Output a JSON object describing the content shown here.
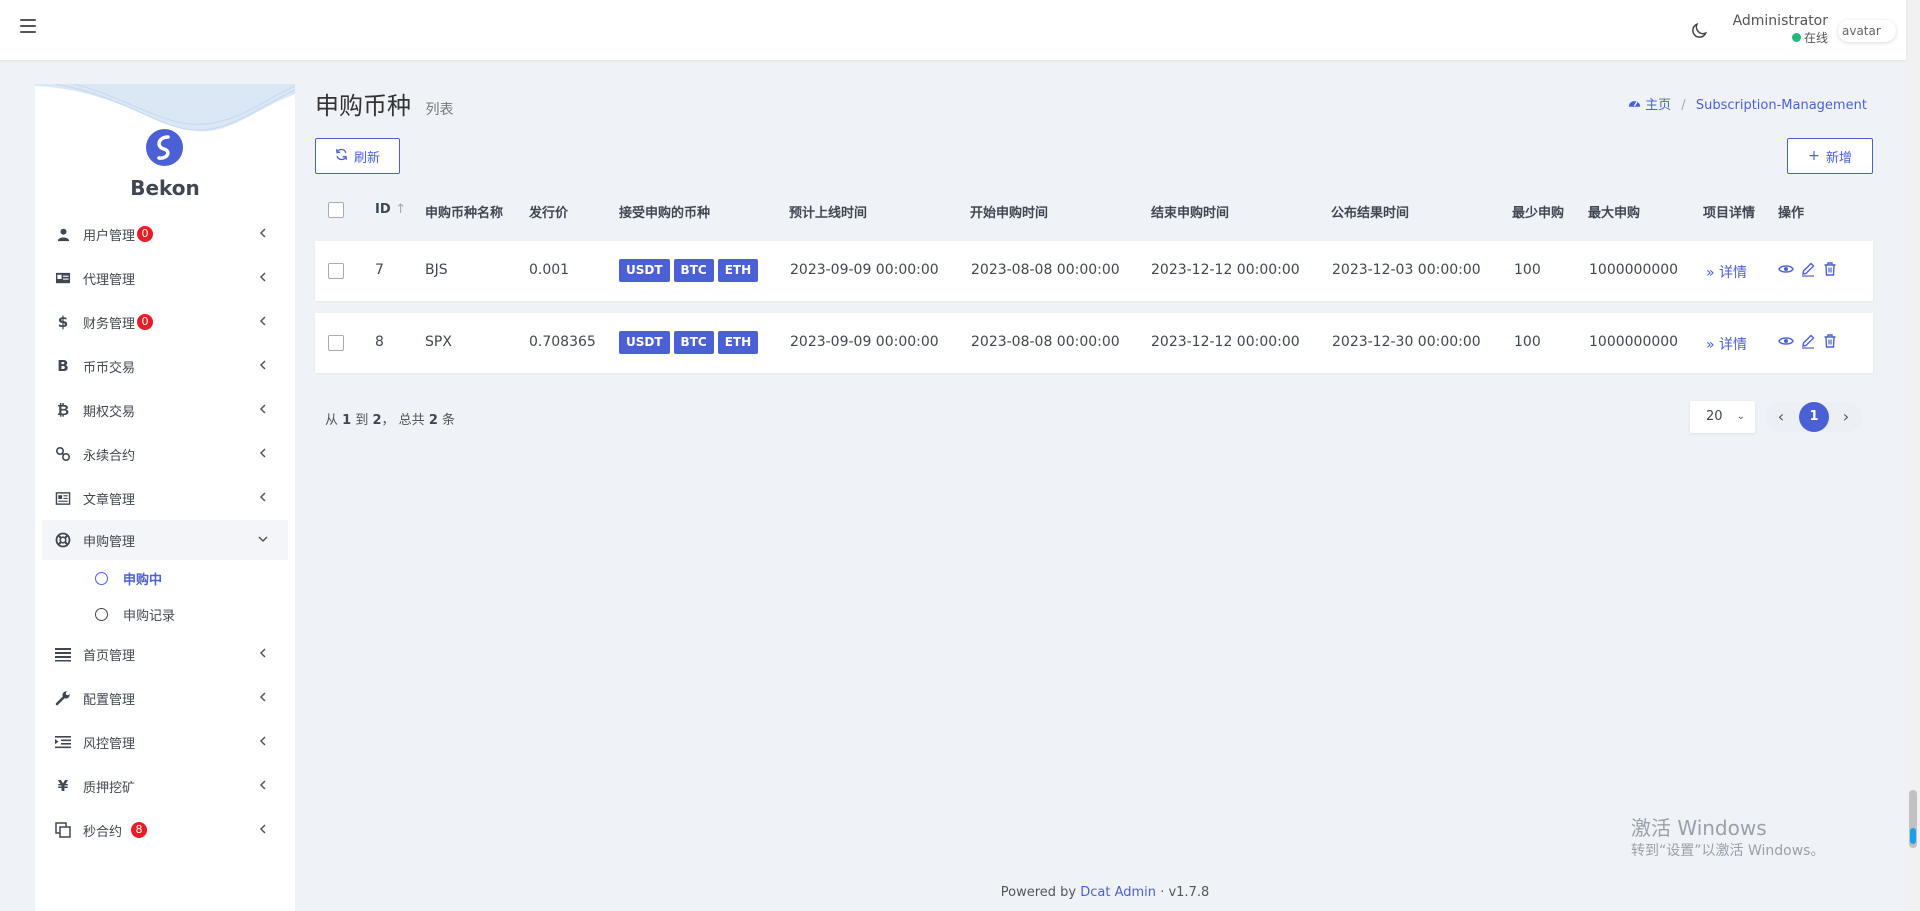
{
  "header": {
    "user_name": "Administrator",
    "user_status": "在线",
    "avatar_alt": "avatar"
  },
  "brand": {
    "name": "Bekon"
  },
  "sidebar": {
    "items": [
      {
        "label": "用户管理",
        "icon": "user-icon",
        "badge": "0"
      },
      {
        "label": "代理管理",
        "icon": "id-card-icon"
      },
      {
        "label": "财务管理",
        "icon": "dollar-icon",
        "badge": "0"
      },
      {
        "label": "币币交易",
        "icon": "bitcoin-b-icon"
      },
      {
        "label": "期权交易",
        "icon": "bitcoin-icon"
      },
      {
        "label": "永续合约",
        "icon": "link-icon"
      },
      {
        "label": "文章管理",
        "icon": "newspaper-icon"
      },
      {
        "label": "申购管理",
        "icon": "life-ring-icon"
      },
      {
        "label": "首页管理",
        "icon": "list-icon"
      },
      {
        "label": "配置管理",
        "icon": "wrench-icon"
      },
      {
        "label": "风控管理",
        "icon": "indent-icon"
      },
      {
        "label": "质押挖矿",
        "icon": "yen-icon"
      },
      {
        "label": "秒合约",
        "icon": "copy-icon",
        "badge": "8"
      }
    ],
    "sub_items": [
      {
        "label": "申购中"
      },
      {
        "label": "申购记录"
      }
    ]
  },
  "page": {
    "title": "申购币种",
    "subtitle": "列表",
    "breadcrumb": {
      "home": "主页",
      "current": "Subscription-Management"
    },
    "refresh_label": "刷新",
    "new_label": "新增"
  },
  "table": {
    "columns": [
      "ID",
      "申购币种名称",
      "发行价",
      "接受申购的币种",
      "预计上线时间",
      "开始申购时间",
      "结束申购时间",
      "公布结果时间",
      "最少申购",
      "最大申购",
      "项目详情",
      "操作"
    ],
    "sort_indicator": "↑",
    "rows": [
      {
        "id": "7",
        "name": "BJS",
        "price": "0.001",
        "currencies": [
          "USDT",
          "BTC",
          "ETH"
        ],
        "online_time": "2023-09-09 00:00:00",
        "start_time": "2023-08-08 00:00:00",
        "end_time": "2023-12-12 00:00:00",
        "result_time": "2023-12-03 00:00:00",
        "min": "100",
        "max": "1000000000",
        "detail": "详情"
      },
      {
        "id": "8",
        "name": "SPX",
        "price": "0.708365",
        "currencies": [
          "USDT",
          "BTC",
          "ETH"
        ],
        "online_time": "2023-09-09 00:00:00",
        "start_time": "2023-08-08 00:00:00",
        "end_time": "2023-12-12 00:00:00",
        "result_time": "2023-12-30 00:00:00",
        "min": "100",
        "max": "1000000000",
        "detail": "详情"
      }
    ]
  },
  "pagination": {
    "summary_prefix": "从",
    "from": "1",
    "to_word": "到",
    "to": "2",
    "total_word": "，  总共",
    "total": "2",
    "unit": "条",
    "per_page": "20",
    "current_page": "1"
  },
  "watermark": {
    "line1": "激活 Windows",
    "line2": "转到“设置”以激活 Windows。"
  },
  "footer": {
    "prefix": "Powered by",
    "link": "Dcat Admin",
    "sep": "·",
    "version": "v1.7.8"
  },
  "colors": {
    "primary": "#4c60d6",
    "badge": "#ea1b26",
    "online": "#21b978",
    "background": "#eff3f8"
  }
}
